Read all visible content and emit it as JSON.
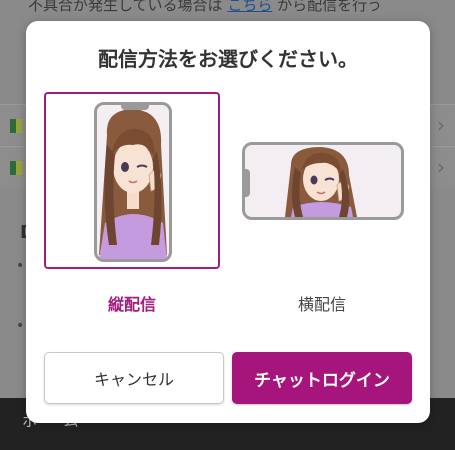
{
  "background": {
    "top_line_text": "不具合が発生している場合は",
    "top_line_link": "こちら",
    "top_line_rest": "から配信を行う",
    "section_letter": "D",
    "footer_text": "ホーム"
  },
  "modal": {
    "title": "配信方法をお選びください。",
    "options": [
      {
        "label": "縦配信",
        "selected": true,
        "icon": "portrait-phone-icon"
      },
      {
        "label": "横配信",
        "selected": false,
        "icon": "landscape-phone-icon"
      }
    ],
    "cancel_label": "キャンセル",
    "login_label": "チャットログイン"
  },
  "colors": {
    "accent": "#a6157b",
    "selected_border": "#a51a7d",
    "overlay_bg": "#8a8a8a"
  }
}
